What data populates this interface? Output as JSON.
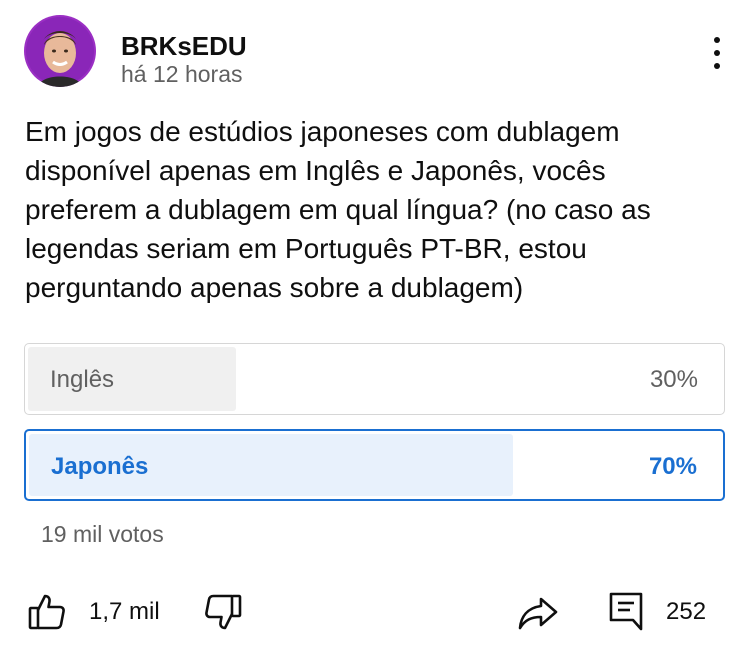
{
  "post": {
    "channel_name": "BRKsEDU",
    "timestamp": "há 12 horas",
    "text": "Em jogos de estúdios japoneses com dublagem disponível apenas em Inglês e Japonês, vocês preferem a dublagem em qual língua? (no caso as legendas seriam em Português PT-BR, estou perguntando apenas sobre a dublagem)"
  },
  "poll": {
    "options": [
      {
        "label": "Inglês",
        "percent_label": "30%",
        "percent": 30,
        "selected": false
      },
      {
        "label": "Japonês",
        "percent_label": "70%",
        "percent": 70,
        "selected": true
      }
    ],
    "votes": "19 mil votos"
  },
  "actions": {
    "like_count": "1,7 mil",
    "comment_count": "252"
  },
  "icons": {
    "menu": "more-vertical-icon",
    "like": "thumbs-up-icon",
    "dislike": "thumbs-down-icon",
    "share": "share-arrow-icon",
    "comment": "comment-icon"
  },
  "colors": {
    "accent": "#1a6fd1",
    "selected_fill": "#e8f1fc",
    "unselected_fill": "#f0f0f0",
    "secondary_text": "#606060"
  }
}
